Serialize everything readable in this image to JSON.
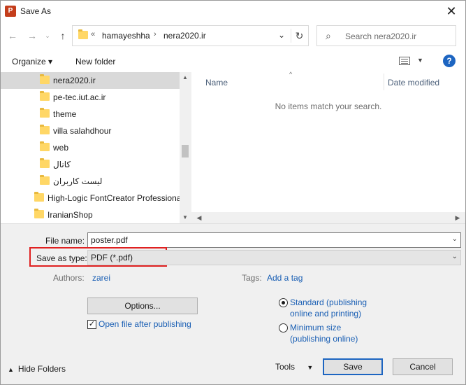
{
  "window": {
    "title": "Save As",
    "app_icon_text": "P"
  },
  "address": {
    "overflow": "«",
    "crumbs": [
      "hamayeshha",
      "nera2020.ir"
    ],
    "separator": "›"
  },
  "search": {
    "placeholder": "Search nera2020.ir"
  },
  "toolbar": {
    "organize": "Organize ▾",
    "new_folder": "New folder",
    "help": "?"
  },
  "nav": {
    "items": [
      {
        "label": "nera2020.ir",
        "selected": true
      },
      {
        "label": "pe-tec.iut.ac.ir"
      },
      {
        "label": "theme"
      },
      {
        "label": "villa salahdhour"
      },
      {
        "label": "web"
      },
      {
        "label": "کانال"
      },
      {
        "label": "لیست کاربران"
      },
      {
        "label": "High-Logic FontCreator Professiona"
      },
      {
        "label": "IranianShop"
      }
    ]
  },
  "content": {
    "columns": [
      "Name",
      "Date modified"
    ],
    "empty_message": "No items match your search."
  },
  "form": {
    "file_name_label": "File name:",
    "file_name_value": "poster.pdf",
    "save_type_label": "Save as type:",
    "save_type_value": "PDF (*.pdf)",
    "authors_label": "Authors:",
    "authors_value": "zarei",
    "tags_label": "Tags:",
    "tags_value": "Add a tag"
  },
  "options": {
    "options_button": "Options...",
    "open_after": "Open file after publishing",
    "open_after_checked": true,
    "standard_line1": "Standard (publishing",
    "standard_line2": "online and printing)",
    "minimum_line1": "Minimum size",
    "minimum_line2": "(publishing online)",
    "selected": "standard"
  },
  "footer": {
    "hide_folders": "Hide Folders",
    "tools": "Tools",
    "save": "Save",
    "cancel": "Cancel"
  }
}
